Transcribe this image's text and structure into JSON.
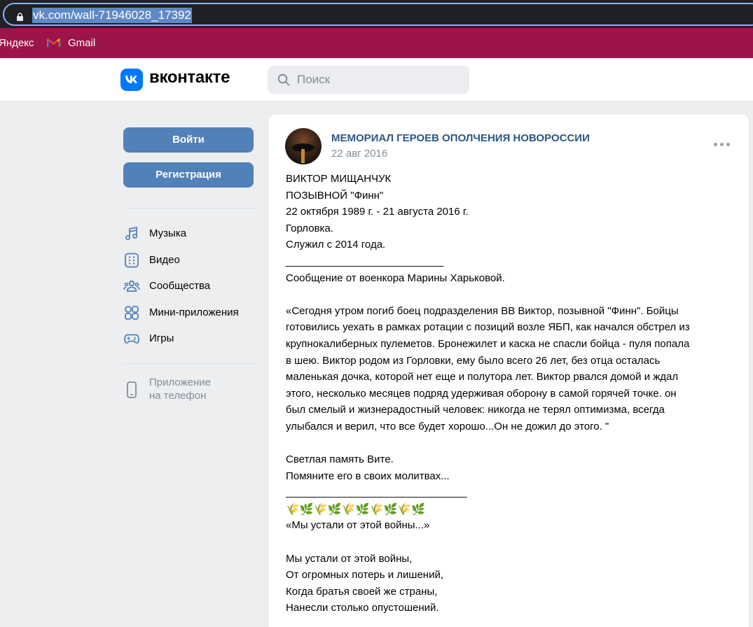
{
  "browser": {
    "url": "vk.com/wall-71946028_17392",
    "bookmarks": [
      {
        "label": "Яндекс"
      },
      {
        "label": "Gmail"
      }
    ]
  },
  "header": {
    "brand": "вконтакте",
    "search_placeholder": "Поиск"
  },
  "sidebar": {
    "login_label": "Войти",
    "register_label": "Регистрация",
    "items": [
      {
        "label": "Музыка",
        "icon": "music-icon"
      },
      {
        "label": "Видео",
        "icon": "video-icon"
      },
      {
        "label": "Сообщества",
        "icon": "communities-icon"
      },
      {
        "label": "Мини-приложения",
        "icon": "mini-apps-icon"
      },
      {
        "label": "Игры",
        "icon": "gamepad-icon"
      }
    ],
    "app_hint_line1": "Приложение",
    "app_hint_line2": "на телефон"
  },
  "post": {
    "author": "МЕМОРИАЛ ГЕРОЕВ ОПОЛЧЕНИЯ НОВОРОССИИ",
    "date": "22 авг 2016",
    "lines": [
      "ВИКТОР МИЩАНЧУК",
      "ПОЗЫВНОЙ \"Финн\"",
      "22 октября 1989 г. - 21 августа 2016 г.",
      "Горловка.",
      "Служил с 2014 года.",
      "___________________________",
      "Сообщение от военкора Марины Харьковой.",
      "",
      "«Сегодня утром погиб боец подразделения ВВ Виктор, позывной \"Финн\". Бойцы",
      "готовились уехать в рамках ротации с позиций возле ЯБП, как начался обстрел из",
      "крупнокалиберных пулеметов. Бронежилет и каска не спасли бойца - пуля попала",
      "в шею. Виктор родом из Горловки, ему было всего 26 лет, без отца осталась",
      "маленькая дочка, которой нет еще и полутора лет. Виктор рвался домой и ждал",
      "этого, несколько месяцев подряд удерживая оборону в самой горячей точке. он",
      "был смелый и жизнерадостный человек: никогда не терял оптимизма, всегда",
      "улыбался и верил, что все будет хорошо...Он не дожил до этого. \"",
      "",
      "Светлая память Вите.",
      "Помяните его в своих молитвах...",
      "_______________________________"
    ],
    "flowers": "🌾🌿🌾🌿🌾🌿🌾🌿🌾🌿",
    "lines_after": [
      "«Мы устали от этой войны...»",
      "",
      "Мы устали от этой войны,",
      "От огромных потерь и лишений,",
      "Когда братья своей же страны,",
      "Нанесли столько опустошений."
    ]
  }
}
